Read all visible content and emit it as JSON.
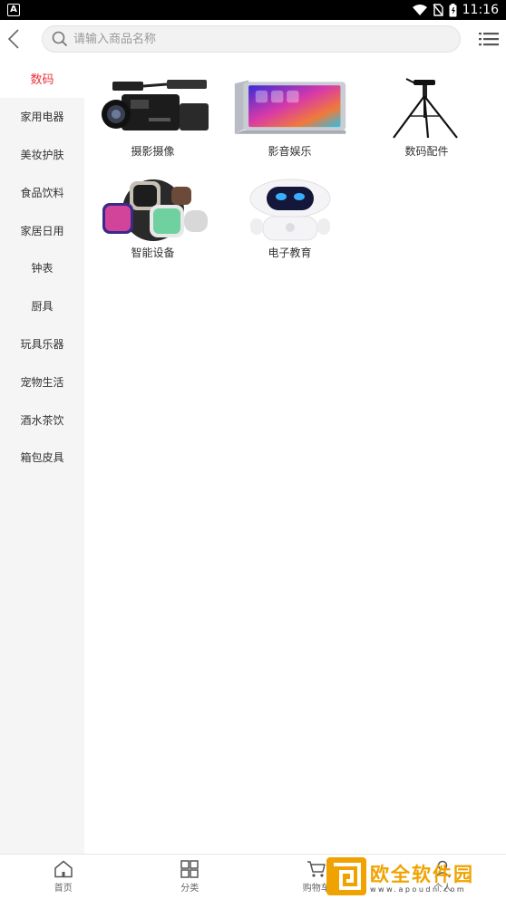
{
  "status_bar": {
    "app_badge": "A",
    "time": "11:16"
  },
  "search": {
    "placeholder": "请输入商品名称"
  },
  "sidebar": {
    "items": [
      {
        "label": "数码"
      },
      {
        "label": "家用电器"
      },
      {
        "label": "美妆护肤"
      },
      {
        "label": "食品饮料"
      },
      {
        "label": "家居日用"
      },
      {
        "label": "钟表"
      },
      {
        "label": "厨具"
      },
      {
        "label": "玩具乐器"
      },
      {
        "label": "宠物生活"
      },
      {
        "label": "酒水茶饮"
      },
      {
        "label": "箱包皮具"
      }
    ],
    "active_index": 0
  },
  "grid": {
    "items": [
      {
        "label": "摄影摄像",
        "icon": "camcorder-image"
      },
      {
        "label": "影音娱乐",
        "icon": "tablet-image"
      },
      {
        "label": "数码配件",
        "icon": "tripod-image"
      },
      {
        "label": "智能设备",
        "icon": "smartwatch-image"
      },
      {
        "label": "电子教育",
        "icon": "robot-image"
      }
    ]
  },
  "tabbar": {
    "items": [
      {
        "label": "首页",
        "icon": "home-icon"
      },
      {
        "label": "分类",
        "icon": "category-icon"
      },
      {
        "label": "购物车",
        "icon": "cart-icon"
      },
      {
        "label": "个人",
        "icon": "user-icon"
      }
    ]
  },
  "watermark": {
    "title": "欧全软件园",
    "url": "www.apoudn.com"
  },
  "colors": {
    "accent": "#e8333c",
    "sidebar_bg": "#f5f5f5",
    "watermark": "#f0a300"
  }
}
